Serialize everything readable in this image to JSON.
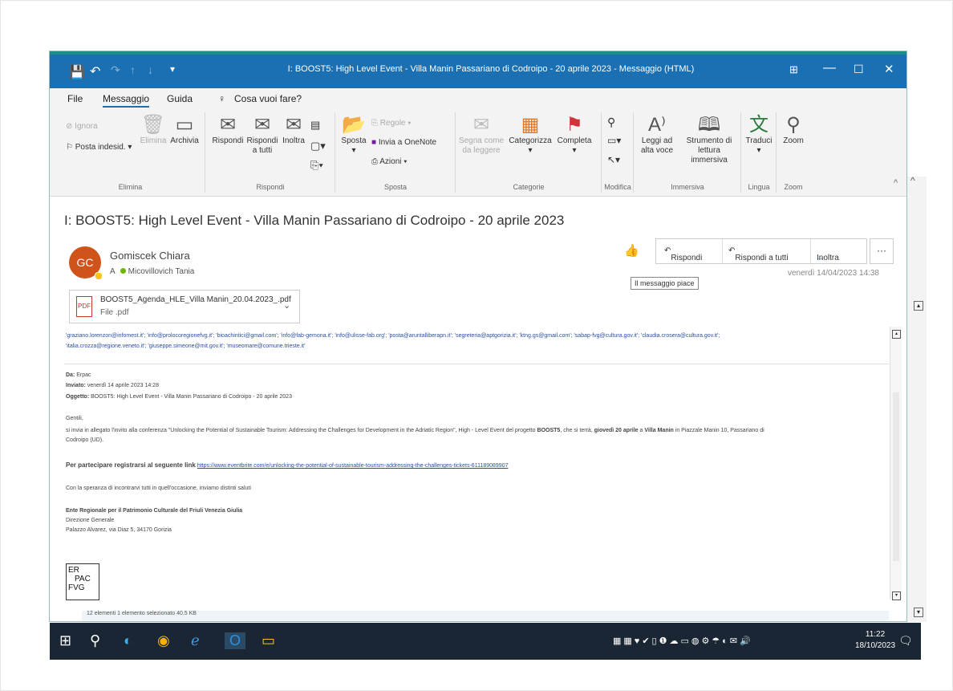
{
  "window": {
    "title": "I: BOOST5: High Level Event - Villa Manin Passariano di Codroipo - 20 aprile 2023  -  Messaggio (HTML)",
    "controls": {
      "layout": "⊞",
      "minimize": "—",
      "maximize": "☐",
      "close": "✕"
    }
  },
  "quick_access": {
    "save": "💾",
    "undo": "↶",
    "redo": "↷",
    "up": "↑",
    "down": "↓",
    "more": "▾"
  },
  "menu": {
    "file": "File",
    "message": "Messaggio",
    "help": "Guida",
    "tell_me": "Cosa vuoi fare?"
  },
  "ribbon": {
    "elimina": {
      "ignore": "Ignora",
      "junk": "Posta indesid.",
      "delete": "Elimina",
      "archive": "Archivia",
      "label": "Elimina"
    },
    "rispondi": {
      "reply": "Rispondi",
      "reply_all": "Rispondi a tutti",
      "forward": "Inoltra",
      "label": "Rispondi"
    },
    "sposta": {
      "move": "Sposta",
      "rules": "Regole",
      "onenote": "Invia a OneNote",
      "actions": "Azioni",
      "label": "Sposta"
    },
    "categorie": {
      "mark_read": "Segna come da leggere",
      "categorize": "Categorizza",
      "followup": "Completa",
      "label": "Categorie"
    },
    "modifica": {
      "label": "Modifica"
    },
    "immersiva": {
      "read_aloud": "Leggi ad alta voce",
      "immersive_reader": "Strumento di lettura immersiva",
      "label": "Immersiva"
    },
    "lingua": {
      "translate": "Traduci",
      "label": "Lingua"
    },
    "zoom": {
      "zoom": "Zoom",
      "label": "Zoom"
    }
  },
  "message": {
    "subject": "I: BOOST5: High Level Event - Villa Manin Passariano di Codroipo - 20 aprile 2023",
    "avatar_initials": "GC",
    "sender": "Gomiscek Chiara",
    "to_prefix": "A",
    "to": "Micovillovich Tania",
    "like_tooltip": "Il messaggio piace",
    "reply": "Rispondi",
    "reply_all": "Rispondi a tutti",
    "forward": "Inoltra",
    "more": "···",
    "date": "venerdì 14/04/2023 14:38",
    "attachment": {
      "name": "BOOST5_Agenda_HLE_Villa Manin_20.04.2023_.pdf",
      "type": "File .pdf",
      "icon_label": "PDF"
    }
  },
  "body": {
    "recipients_line1": "'graziano.lorenzon@infomest.it'; 'info@prolocoregionefvg.it'; 'bioachintici@gmail.com'; 'info@fab-gemona.it'; 'info@ulisse-fab.org'; 'posta@aruntalliberapn.it'; 'segreteria@aptgorizia.it'; 'ktng.gs@gmail.com'; 'sabap-fvg@cultura.gov.it'; 'claudia.crosera@cultura.gov.it';",
    "recipients_line2": "'italia.crozza@regione.veneto.it'; 'giuseppe.simeone@mit.gov.it'; 'museomare@comune.trieste.it'",
    "from_label": "Da:",
    "from_value": "Erpac",
    "sent_label": "Inviato:",
    "sent_value": "venerdì 14 aprile 2023 14:28",
    "subject_label": "Oggetto:",
    "subject_value": "BOOST5: High Level Event - Villa Manin Passariano di Codroipo - 20 aprile 2023",
    "greeting": "Gentili,",
    "para1_a": "si invia in allegato l'invito alla conferenza \"Unlocking the Potential of Sustainable Tourism: Addressing the Challenges for Development in the Adriatic Region\", High - Level Event del progetto ",
    "para1_b": "BOOST5",
    "para1_c": ", che si terrà, ",
    "para1_d": "giovedì 20 aprile",
    "para1_e": " a ",
    "para1_f": "Villa Manin",
    "para1_g": " in Piazzale Manin 10, Passariano di",
    "para1_h": "Codroipo (UD).",
    "register_text": "Per partecipare registrarsi al seguente link",
    "register_link": "https://www.eventbrite.com/e/unlocking-the-potential-of-sustainable-tourism-addressing-the-challenges-tickets-611189089907",
    "closing": "Con la speranza di incontrarvi tutti in quell'occasione, inviamo distinti saluti",
    "org": "Ente Regionale per il Patrimonio Culturale del Friuli Venezia Giulia",
    "dept": "Direzione Generale",
    "address": "Palazzo Alvarez, via Diaz 5, 34170 Gorizia",
    "logo": [
      "ER",
      "PAC",
      "FVG"
    ],
    "statusbar": "12 elementi     1 elemento selezionato  40.5 KB"
  },
  "taskbar": {
    "start": "⊞",
    "search": "⚲",
    "edge_new": "◐",
    "chrome": "◉",
    "ie": "ℯ",
    "outlook": "O",
    "explorer": "▭",
    "tray": "▦▦♥✔▯❶☁▭◍⚙☂◐✉🔊",
    "time": "11:22",
    "date": "18/10/2023",
    "notifications": "🗨"
  }
}
